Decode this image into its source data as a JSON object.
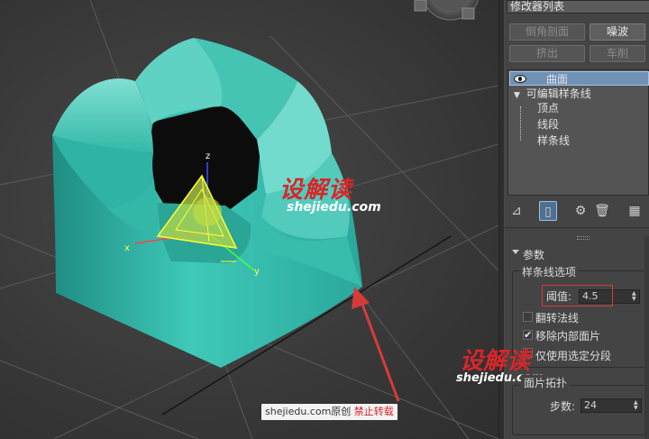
{
  "panel": {
    "modifier_list": "修改器列表",
    "buttons": {
      "chamfer": "倒角剖面",
      "noise": "噪波",
      "extrude": "挤出",
      "lathe": "车削"
    },
    "stack": {
      "items": [
        {
          "label": "曲面",
          "selected": true
        },
        {
          "label": "可编辑样条线"
        },
        {
          "label": "顶点"
        },
        {
          "label": "线段"
        },
        {
          "label": "样条线"
        }
      ]
    },
    "params": {
      "rollout_title": "参数",
      "spline_options_group": "样条线选项",
      "threshold_label": "阈值:",
      "threshold_value": "4.5",
      "flip_normals": "翻转法线",
      "remove_interior": "移除内部面片",
      "use_selected": "仅使用选定分段",
      "patch_topology_group": "面片拓扑",
      "steps_label": "步数:",
      "steps_value": "24"
    }
  },
  "viewport": {
    "axis_labels": {
      "z": "z",
      "x": "x",
      "y": "y"
    },
    "watermark": {
      "brand": "设解读",
      "url": "shejiedu.com"
    },
    "credit": {
      "site": "shejiedu.com",
      "original": "原创",
      "forbid": "禁止转载"
    }
  },
  "colors": {
    "object": "#3cc4b4",
    "selection": "#6f91b6",
    "highlight": "#d83a3a"
  }
}
